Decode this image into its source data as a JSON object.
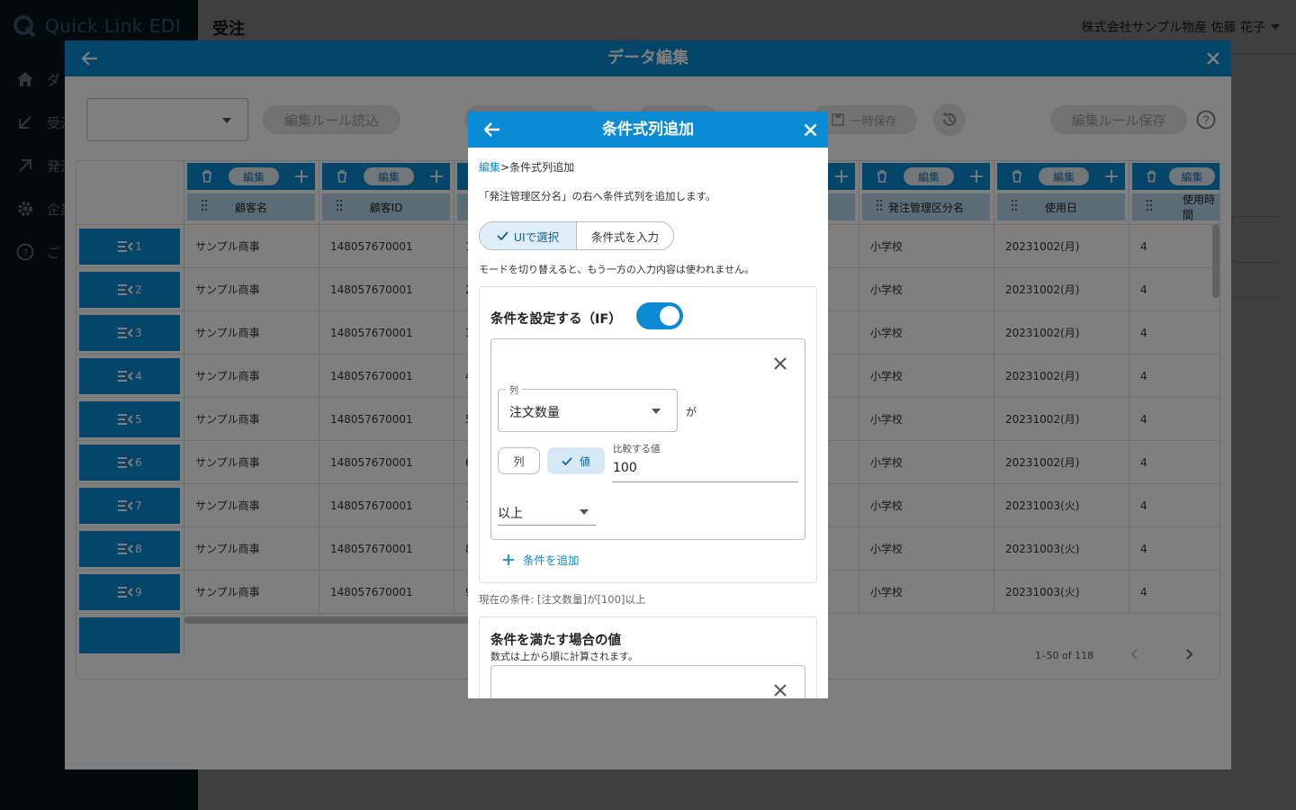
{
  "app": {
    "logo": "Quick Link EDI",
    "page_title": "受注",
    "user": "株式会社サンプル物産 佐藤 花子",
    "nav": [
      {
        "label": "ダ",
        "icon": "home-icon"
      },
      {
        "label": "受注",
        "icon": "arrow-down-left-icon"
      },
      {
        "label": "発注",
        "icon": "arrow-up-right-icon"
      },
      {
        "label": "企業",
        "icon": "gear-icon"
      },
      {
        "label": "ご",
        "icon": "help-icon"
      }
    ]
  },
  "data_edit": {
    "title": "データ編集",
    "load_rule": "編集ルール読込",
    "temp_save": "一時保存",
    "save_rule": "編集ルール保存",
    "edit_label": "編集",
    "columns": [
      "顧客名",
      "顧客ID",
      "",
      "",
      "",
      "発注管理区分名",
      "使用日",
      "使用時間"
    ],
    "rows": [
      {
        "no": "1",
        "customer": "サンプル商事",
        "id": "148057670001",
        "c3": "1",
        "class": "小学校",
        "date": "20231002(月)",
        "time": "4"
      },
      {
        "no": "2",
        "customer": "サンプル商事",
        "id": "148057670001",
        "c3": "2",
        "class": "小学校",
        "date": "20231002(月)",
        "time": "4"
      },
      {
        "no": "3",
        "customer": "サンプル商事",
        "id": "148057670001",
        "c3": "3",
        "class": "小学校",
        "date": "20231002(月)",
        "time": "4"
      },
      {
        "no": "4",
        "customer": "サンプル商事",
        "id": "148057670001",
        "c3": "4",
        "class": "小学校",
        "date": "20231002(月)",
        "time": "4"
      },
      {
        "no": "5",
        "customer": "サンプル商事",
        "id": "148057670001",
        "c3": "5",
        "class": "小学校",
        "date": "20231002(月)",
        "time": "4"
      },
      {
        "no": "6",
        "customer": "サンプル商事",
        "id": "148057670001",
        "c3": "6",
        "class": "小学校",
        "date": "20231002(月)",
        "time": "4"
      },
      {
        "no": "7",
        "customer": "サンプル商事",
        "id": "148057670001",
        "c3": "7",
        "class": "小学校",
        "date": "20231003(火)",
        "time": "4"
      },
      {
        "no": "8",
        "customer": "サンプル商事",
        "id": "148057670001",
        "c3": "8",
        "class": "小学校",
        "date": "20231003(火)",
        "time": "4"
      },
      {
        "no": "9",
        "customer": "サンプル商事",
        "id": "148057670001",
        "c3": "9",
        "class": "小学校",
        "date": "20231003(火)",
        "time": "4"
      }
    ],
    "pagination": "1–50 of 118"
  },
  "condition_dialog": {
    "title": "条件式列追加",
    "breadcrumb_link": "編集",
    "breadcrumb_sep": ">",
    "breadcrumb_current": "条件式列追加",
    "description": "「発注管理区分名」の右へ条件式列を追加します。",
    "mode_ui": "UIで選択",
    "mode_expr": "条件式を入力",
    "mode_note": "モードを切り替えると、もう一方の入力内容は使われません。",
    "if_title": "条件を設定する（IF）",
    "column_label": "列",
    "column_value": "注文数量",
    "ga": "が",
    "chip_column": "列",
    "chip_value": "値",
    "compare_label": "比較する値",
    "compare_value": "100",
    "operator": "以上",
    "add_condition": "条件を追加",
    "current_condition": "現在の条件: [注文数量]が[100]以上",
    "then_title": "条件を満たす場合の値",
    "then_note": "数式は上から順に計算されます。"
  },
  "colors": {
    "primary": "#0b8bd4",
    "header_cell": "#b8d8ee",
    "sidebar": "#0c2a3a"
  }
}
